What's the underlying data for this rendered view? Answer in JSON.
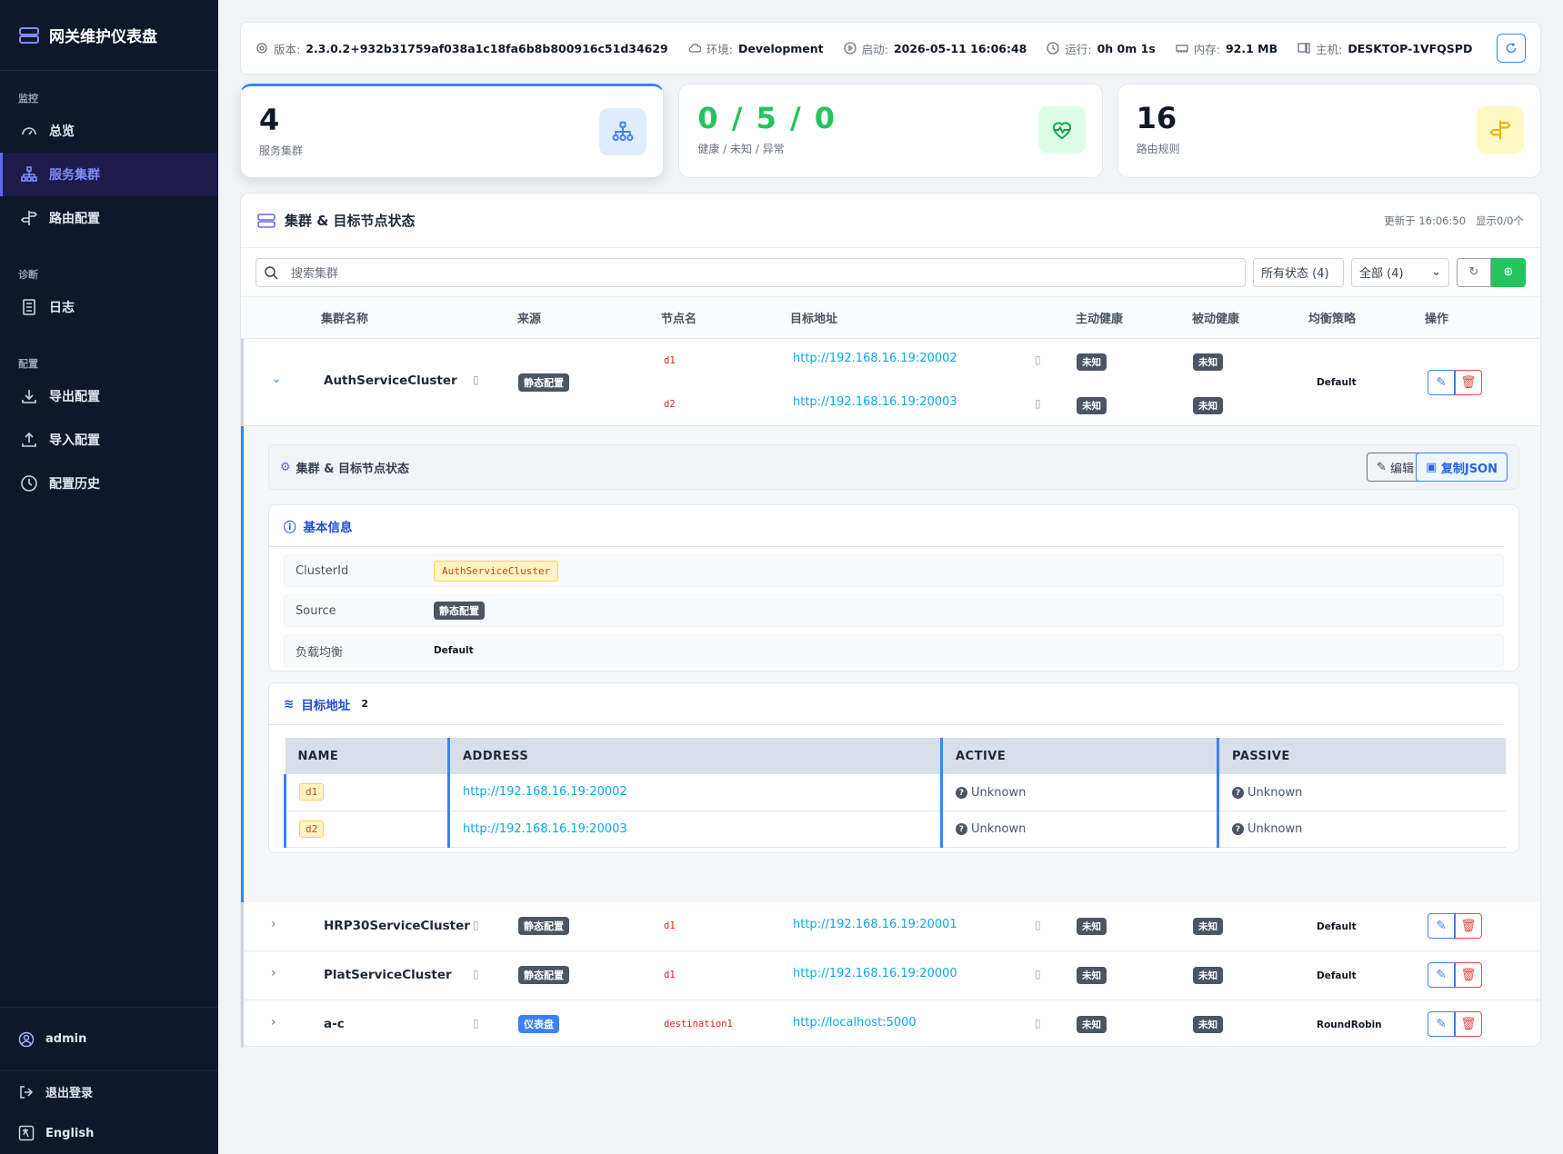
{
  "app": {
    "title": "网关维护仪表盘"
  },
  "sidebar": {
    "sections": [
      {
        "title": "监控",
        "items": [
          {
            "label": "总览"
          },
          {
            "label": "服务集群"
          },
          {
            "label": "路由配置"
          }
        ]
      },
      {
        "title": "诊断",
        "items": [
          {
            "label": "日志"
          }
        ]
      },
      {
        "title": "配置",
        "items": [
          {
            "label": "导出配置"
          },
          {
            "label": "导入配置"
          },
          {
            "label": "配置历史"
          }
        ]
      }
    ],
    "active": "服务集群",
    "user": "admin",
    "logout": "退出登录",
    "language": "English"
  },
  "topbar": {
    "version_label": "版本:",
    "version": "2.3.0.2+932b31759af038a1c18fa6b8b800916c51d34629",
    "env_label": "环境:",
    "env": "Development",
    "start_label": "启动:",
    "start": "2026-05-11 16:06:48",
    "uptime_label": "运行:",
    "uptime": "0h 0m 1s",
    "mem_label": "内存:",
    "mem": "92.1 MB",
    "host_label": "主机:",
    "host": "DESKTOP-1VFQSPD"
  },
  "stats": [
    {
      "value": "4",
      "caption": "服务集群"
    },
    {
      "value": "0 / 5 / 0",
      "caption": "健康 / 未知 / 异常"
    },
    {
      "value": "16",
      "caption": "路由规则"
    }
  ],
  "panel": {
    "title": "集群 & 目标节点状态",
    "updated": "更新于 16:06:50",
    "shown": "显示0/0个",
    "search_placeholder": "搜索集群",
    "filter_status": "所有状态 (4)",
    "filter_all": "全部 (4)",
    "columns": [
      "集群名称",
      "来源",
      "节点名",
      "目标地址",
      "主动健康",
      "被动健康",
      "均衡策略",
      "操作"
    ]
  },
  "clusters": [
    {
      "name": "AuthServiceCluster",
      "source": "静态配置",
      "nodes": [
        {
          "name": "d1",
          "address": "http://192.168.16.19:20002",
          "active": "未知",
          "passive": "未知"
        },
        {
          "name": "d2",
          "address": "http://192.168.16.19:20003",
          "active": "未知",
          "passive": "未知"
        }
      ],
      "policy": "Default"
    },
    {
      "name": "HRP30ServiceCluster",
      "source": "静态配置",
      "nodes": [
        {
          "name": "d1",
          "address": "http://192.168.16.19:20001",
          "active": "未知",
          "passive": "未知"
        }
      ],
      "policy": "Default"
    },
    {
      "name": "PlatServiceCluster",
      "source": "静态配置",
      "nodes": [
        {
          "name": "d1",
          "address": "http://192.168.16.19:20000",
          "active": "未知",
          "passive": "未知"
        }
      ],
      "policy": "Default"
    },
    {
      "name": "a-c",
      "source": "仪表盘",
      "nodes": [
        {
          "name": "destination1",
          "address": "http://localhost:5000",
          "active": "未知",
          "passive": "未知"
        }
      ],
      "policy": "RoundRobin"
    }
  ],
  "detail": {
    "title": "集群 & 目标节点状态",
    "edit": "编辑",
    "copy_json": "复制JSON",
    "basic_title": "基本信息",
    "kv": [
      {
        "key": "ClusterId",
        "value": "AuthServiceCluster"
      },
      {
        "key": "Source",
        "value": "静态配置"
      },
      {
        "key": "负载均衡",
        "value": "Default"
      }
    ],
    "dest_title": "目标地址",
    "dest_count": "2",
    "dest_columns": [
      "NAME",
      "ADDRESS",
      "ACTIVE",
      "PASSIVE"
    ],
    "dest_rows": [
      {
        "name": "d1",
        "address": "http://192.168.16.19:20002",
        "active": "Unknown",
        "passive": "Unknown"
      },
      {
        "name": "d2",
        "address": "http://192.168.16.19:20003",
        "active": "Unknown",
        "passive": "Unknown"
      }
    ]
  },
  "colors": {
    "accent": "#3b82f6",
    "sidebar_bg": "#0f172a",
    "healthy": "#22c55e"
  }
}
